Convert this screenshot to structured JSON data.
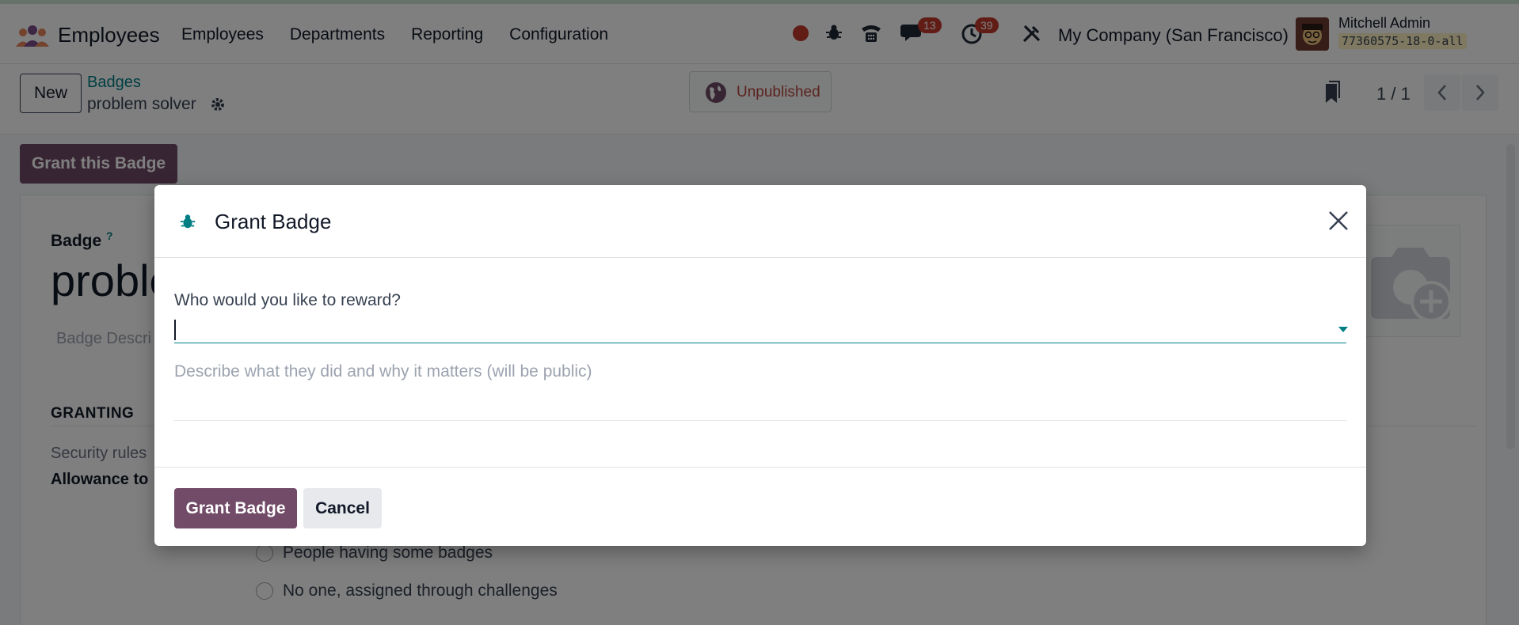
{
  "navbar": {
    "app_name": "Employees",
    "menu": [
      "Employees",
      "Departments",
      "Reporting",
      "Configuration"
    ],
    "messages_count": "13",
    "activities_count": "39",
    "company": "My Company (San Francisco)",
    "user_name": "Mitchell Admin",
    "db_name": "77360575-18-0-all"
  },
  "control_panel": {
    "new_label": "New",
    "breadcrumb_parent": "Badges",
    "breadcrumb_current": "problem solver",
    "publish_status": "Unpublished",
    "pager_value": "1 / 1"
  },
  "form": {
    "grant_button": "Grant this Badge",
    "badge_label": "Badge",
    "help_mark": "?",
    "badge_name_partial": "proble",
    "description_partial": "Badge Descri",
    "section_granting": "GRANTING",
    "security_rules_partial": "Security rules",
    "allowance_partial": "Allowance to",
    "radio_options": [
      "People having some badges",
      "No one, assigned through challenges"
    ]
  },
  "modal": {
    "title": "Grant Badge",
    "question": "Who would you like to reward?",
    "user_value": "",
    "description_placeholder": "Describe what they did and why it matters (will be public)",
    "grant_label": "Grant Badge",
    "cancel_label": "Cancel"
  },
  "colors": {
    "brand": "#714b67",
    "accent": "#017e84",
    "badge_red": "#c0392b",
    "unpublished": "#b8473f"
  }
}
